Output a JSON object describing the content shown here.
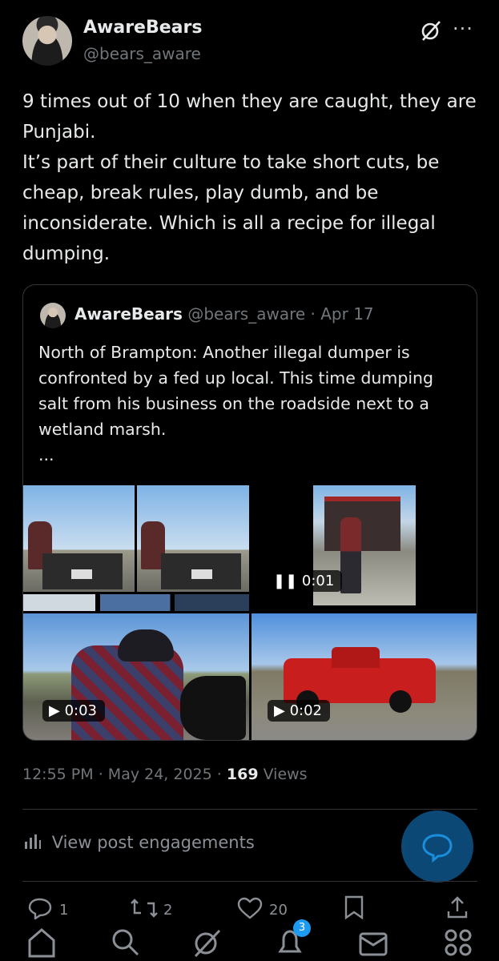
{
  "post": {
    "author_name": "AwareBears",
    "author_handle": "@bears_aware",
    "text": "9 times out of 10 when they are caught, they are Punjabi.\nIt’s part of their culture to take short cuts, be cheap, break rules, play dumb, and be inconsiderate. Which is all a recipe for illegal dumping."
  },
  "quote": {
    "author_name": "AwareBears",
    "author_handle": "@bears_aware",
    "separator": "·",
    "date": "Apr 17",
    "text": "North of Brampton: Another illegal dumper is confronted by a fed up local. This time dumping salt from his business on the roadside next to a wetland marsh.",
    "ellipsis": "...",
    "media": [
      {
        "type": "video",
        "duration": "0:01",
        "state": "pause"
      },
      {
        "type": "video",
        "duration": "0:03",
        "state": "play"
      },
      {
        "type": "video",
        "duration": "0:02",
        "state": "play"
      }
    ]
  },
  "meta": {
    "time": "12:55 PM",
    "sep1": "·",
    "date": "May 24, 2025",
    "sep2": "·",
    "views_count": "169",
    "views_label": "Views"
  },
  "engagements_label": "View post engagements",
  "actions": {
    "replies": "1",
    "reposts": "2",
    "likes": "20"
  },
  "nav": {
    "notifications_badge": "3"
  },
  "icons": [
    "grok-icon",
    "more-icon",
    "reply-icon",
    "repost-icon",
    "like-icon",
    "bookmark-icon",
    "share-icon",
    "home-icon",
    "search-icon",
    "notifications-icon",
    "messages-icon",
    "communities-icon",
    "analytics-icon",
    "chat-bubble-icon"
  ],
  "colors": {
    "accent": "#1d9bf0",
    "background": "#000000",
    "muted": "#71767b"
  }
}
